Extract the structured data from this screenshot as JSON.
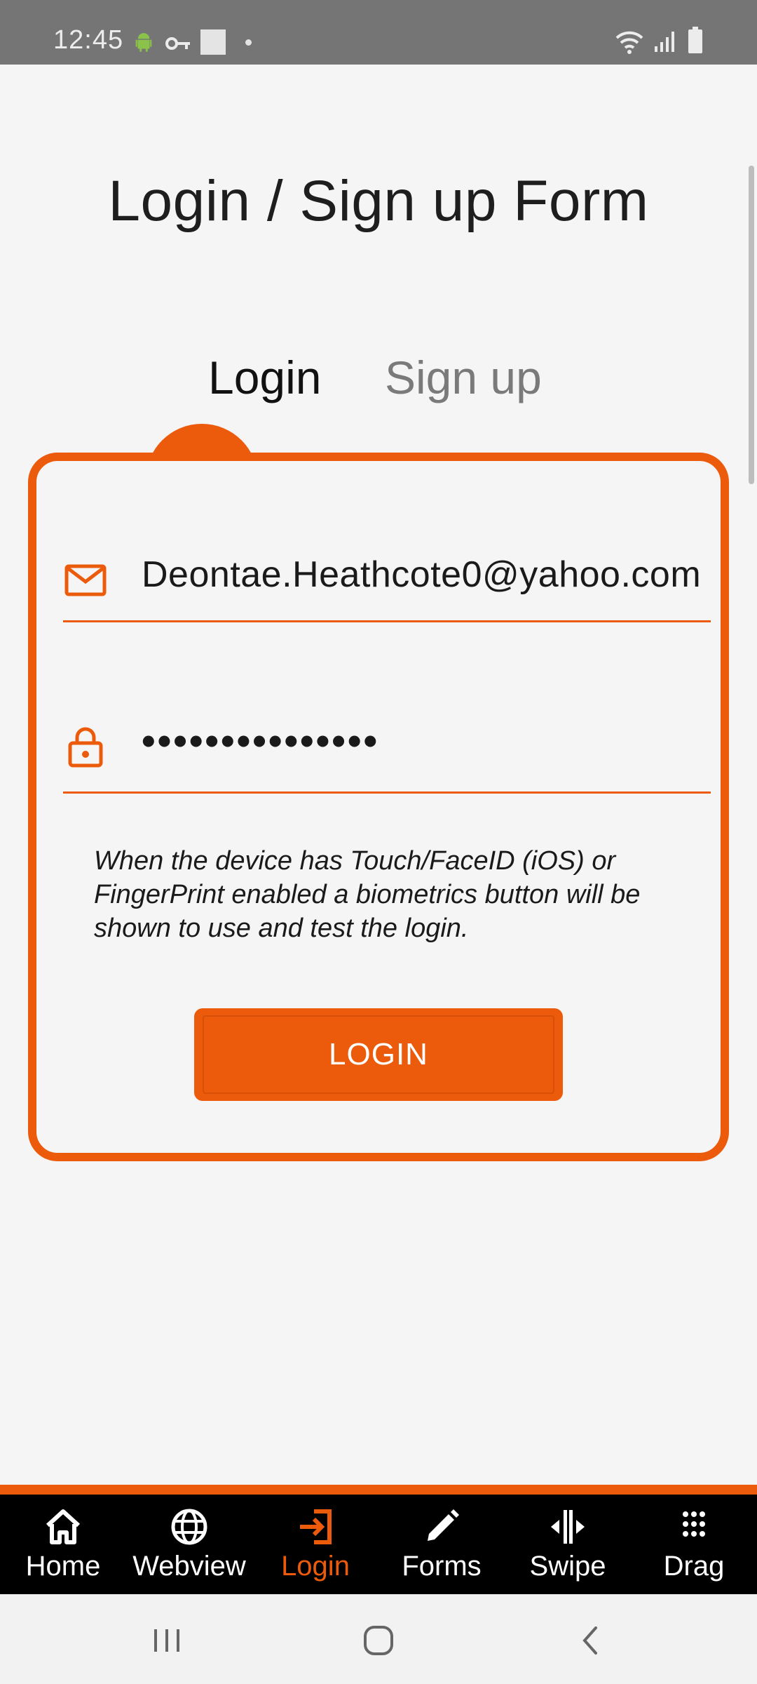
{
  "status_bar": {
    "time": "12:45",
    "left_icons": [
      "android-icon",
      "key-icon",
      "notification-square-icon",
      "dot-icon"
    ],
    "right_icons": [
      "wifi-icon",
      "signal-icon",
      "battery-icon"
    ]
  },
  "page": {
    "title": "Login / Sign up Form"
  },
  "tabs": [
    {
      "label": "Login",
      "active": true
    },
    {
      "label": "Sign up",
      "active": false
    }
  ],
  "form": {
    "email": {
      "value": "Deontae.Heathcote0@yahoo.com",
      "icon": "mail-icon"
    },
    "password": {
      "value": "•••••••••••••••",
      "icon": "lock-icon"
    },
    "help_text": "When the device has Touch/FaceID (iOS) or FingerPrint enabled a biometrics button will be shown to use and test the login.",
    "submit_label": "LOGIN"
  },
  "bottom_nav": [
    {
      "label": "Home",
      "icon": "home-icon",
      "active": false
    },
    {
      "label": "Webview",
      "icon": "globe-icon",
      "active": false
    },
    {
      "label": "Login",
      "icon": "login-icon",
      "active": true
    },
    {
      "label": "Forms",
      "icon": "pencil-icon",
      "active": false
    },
    {
      "label": "Swipe",
      "icon": "swipe-icon",
      "active": false
    },
    {
      "label": "Drag",
      "icon": "grid-dots-icon",
      "active": false
    }
  ],
  "colors": {
    "accent": "#ec5b0c",
    "status_bar": "#757575",
    "background": "#f5f5f5",
    "tab_bar": "#000000"
  }
}
